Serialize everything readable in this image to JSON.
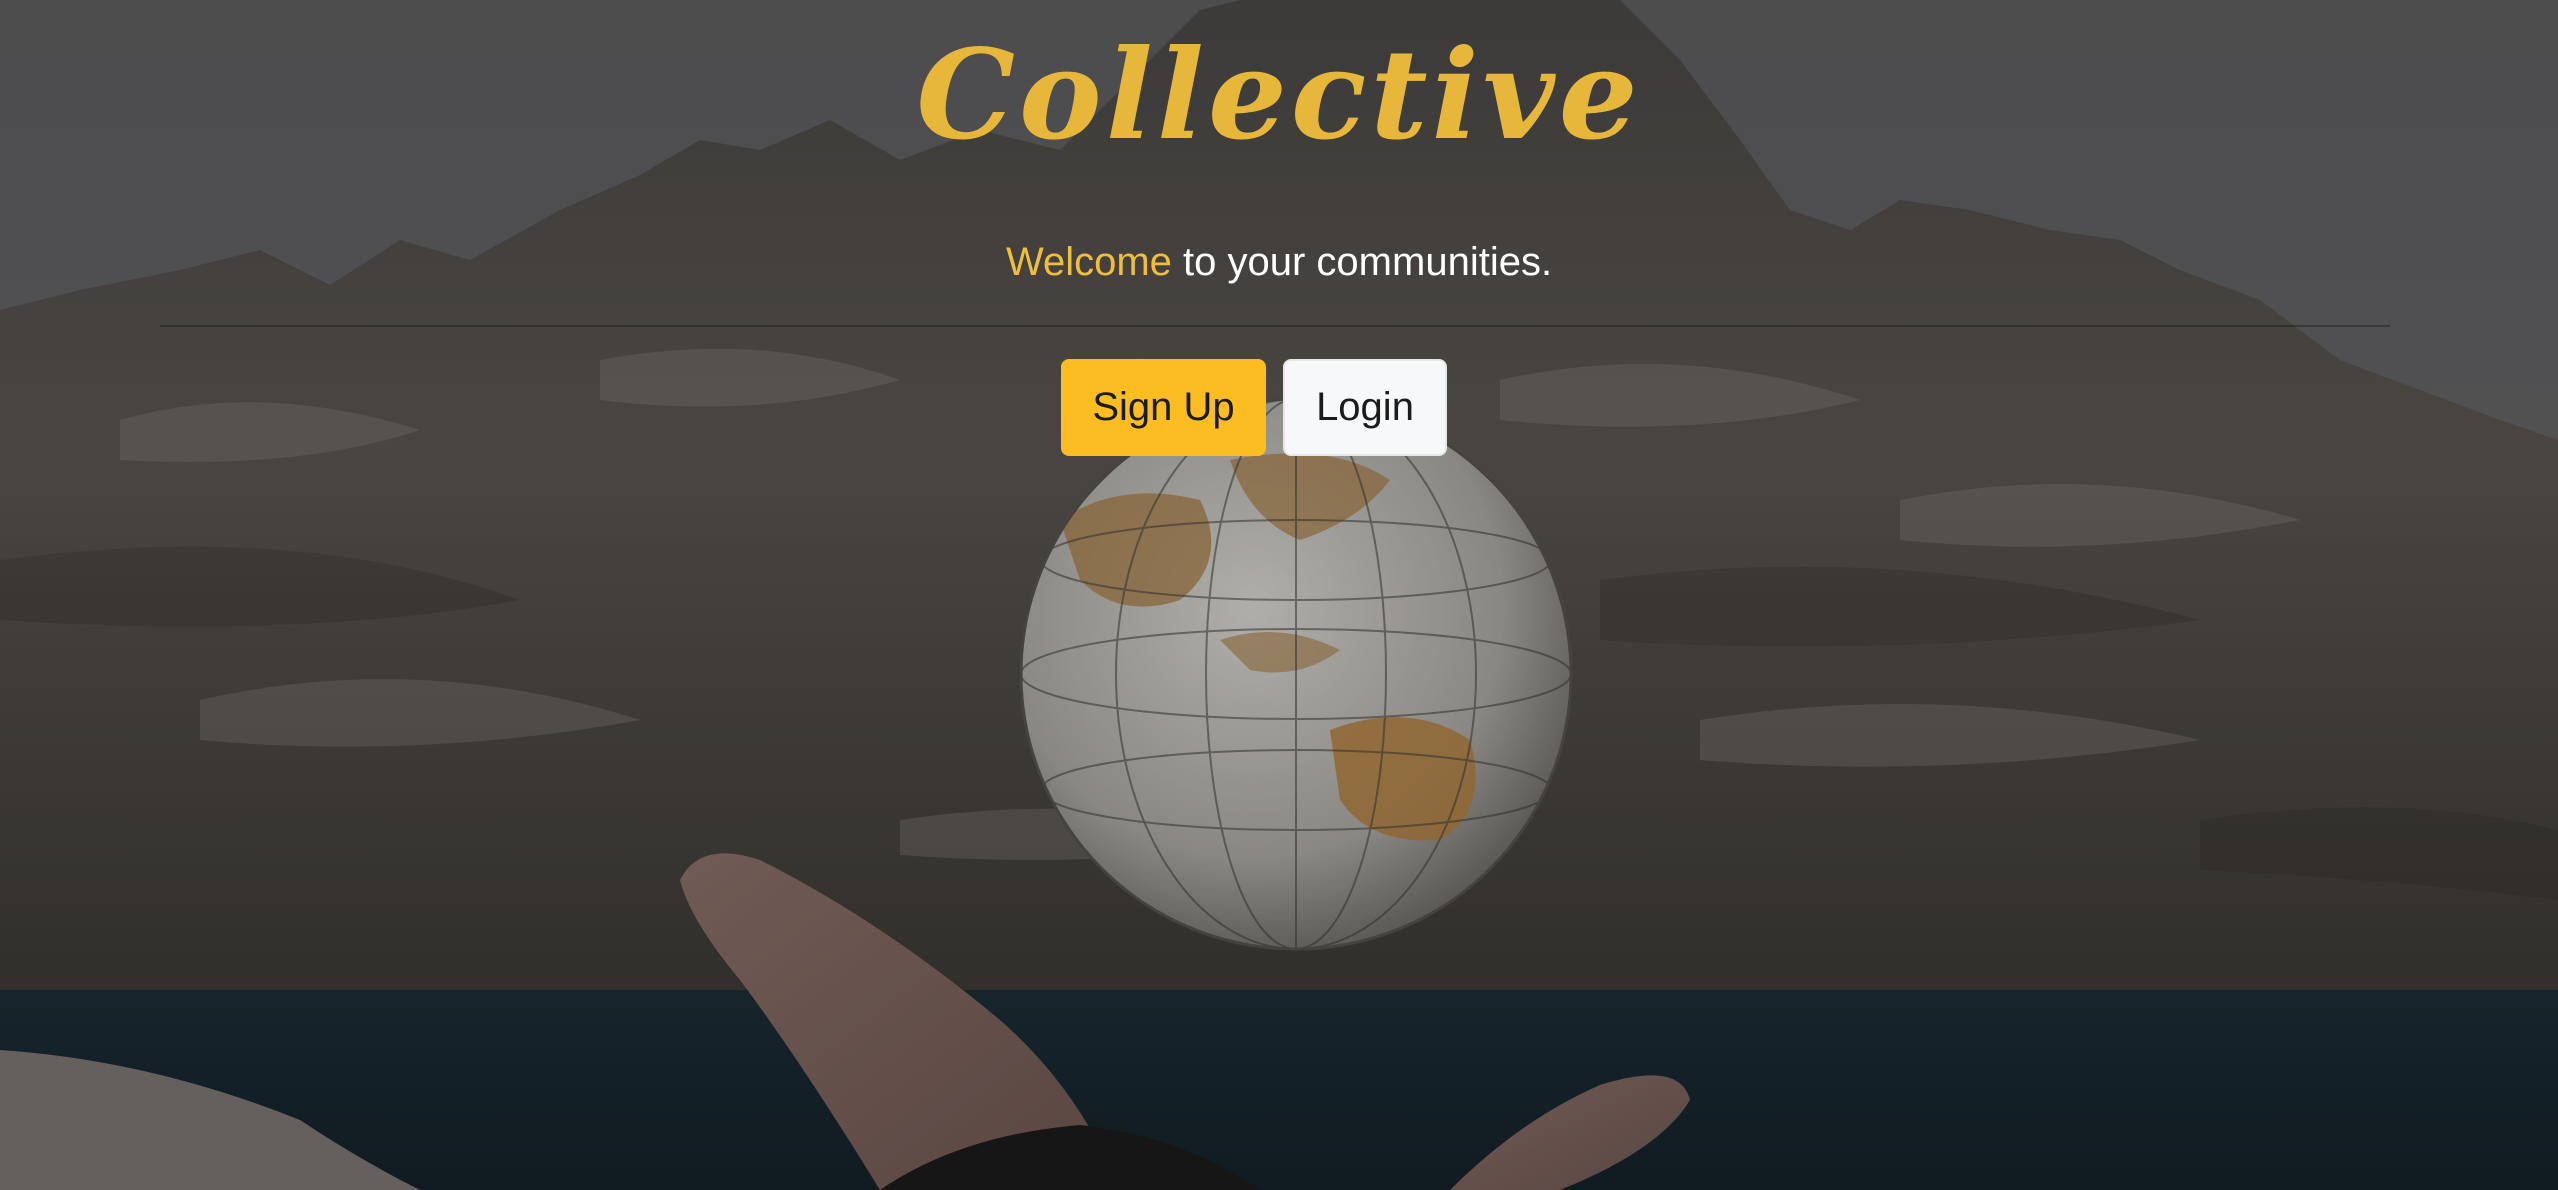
{
  "brand": {
    "name": "Collective",
    "color": "#E7B73C"
  },
  "hero": {
    "welcome_accent": "Welcome",
    "welcome_rest": " to your communities.",
    "accent_color": "#F0BE3A",
    "background_image": "mountain-globe-hand-photo"
  },
  "actions": {
    "signup_label": "Sign Up",
    "signup_color": "#FBBD22",
    "login_label": "Login",
    "login_color": "#F7F8FA"
  }
}
